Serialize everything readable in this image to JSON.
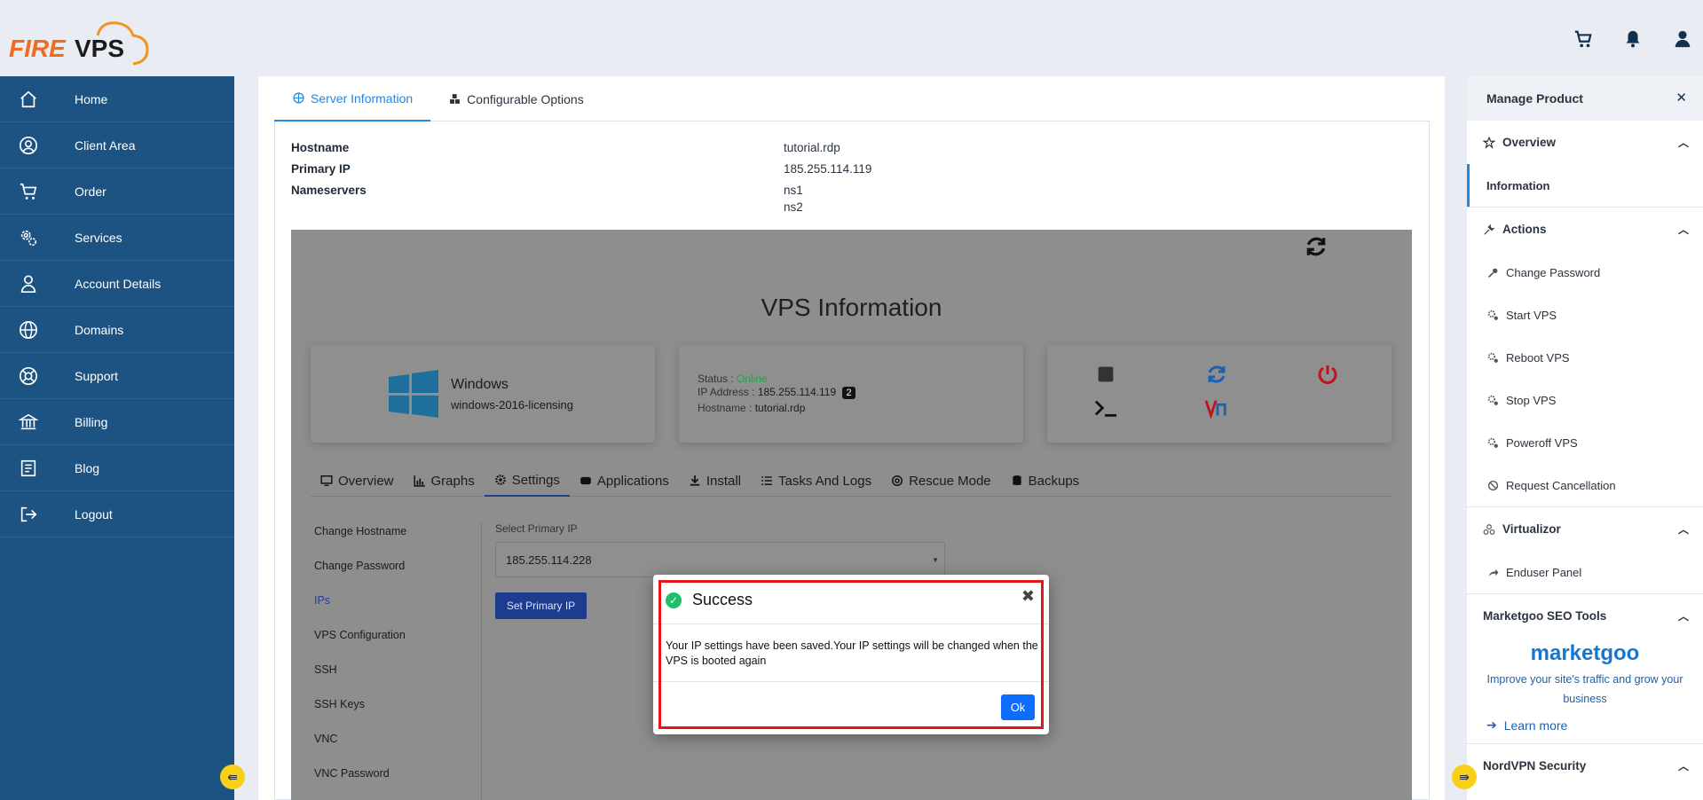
{
  "brand": {
    "logo_text_left": "FIRE",
    "logo_text_right": "VPS"
  },
  "header": {
    "icons": [
      "cart-icon",
      "bell-icon",
      "user-icon"
    ]
  },
  "sidebar": {
    "items": [
      {
        "label": "Home",
        "icon": "home-icon"
      },
      {
        "label": "Client Area",
        "icon": "user-circle-icon"
      },
      {
        "label": "Order",
        "icon": "cart-icon"
      },
      {
        "label": "Services",
        "icon": "gears-icon"
      },
      {
        "label": "Account Details",
        "icon": "user-icon"
      },
      {
        "label": "Domains",
        "icon": "globe-icon"
      },
      {
        "label": "Support",
        "icon": "lifering-icon"
      },
      {
        "label": "Billing",
        "icon": "bank-icon"
      },
      {
        "label": "Blog",
        "icon": "book-icon"
      },
      {
        "label": "Logout",
        "icon": "logout-icon"
      }
    ]
  },
  "main": {
    "tabs": [
      {
        "label": "Server Information",
        "icon": "globe-icon"
      },
      {
        "label": "Configurable Options",
        "icon": "cubes-icon"
      }
    ],
    "info": {
      "hostname_label": "Hostname",
      "hostname_value": "tutorial.rdp",
      "ip_label": "Primary IP",
      "ip_value": "185.255.114.119",
      "ns_label": "Nameservers",
      "ns1": "ns1",
      "ns2": "ns2"
    }
  },
  "vps": {
    "title": "VPS Information",
    "os_name": "Windows",
    "os_sub": "windows-2016-licensing",
    "status_label": "Status :",
    "status_value": "Online",
    "ip_label": "IP Address :",
    "ip_value": "185.255.114.119",
    "ip_count": "2",
    "host_label": "Hostname :",
    "host_value": "tutorial.rdp",
    "tabs": [
      {
        "label": "Overview",
        "icon": "monitor-icon"
      },
      {
        "label": "Graphs",
        "icon": "chart-icon"
      },
      {
        "label": "Settings",
        "icon": "gear-icon"
      },
      {
        "label": "Applications",
        "icon": "apps-icon"
      },
      {
        "label": "Install",
        "icon": "download-icon"
      },
      {
        "label": "Tasks And Logs",
        "icon": "list-icon"
      },
      {
        "label": "Rescue Mode",
        "icon": "lifering-icon"
      },
      {
        "label": "Backups",
        "icon": "database-icon"
      }
    ],
    "menu": [
      "Change Hostname",
      "Change Password",
      "IPs",
      "VPS Configuration",
      "SSH",
      "SSH Keys",
      "VNC",
      "VNC Password"
    ],
    "select_label": "Select Primary IP",
    "select_value": "185.255.114.228",
    "set_button": "Set Primary IP"
  },
  "modal": {
    "title": "Success",
    "message": "Your IP settings have been saved.Your IP settings will be changed when the VPS is booted again",
    "ok": "Ok"
  },
  "right_panel": {
    "title": "Manage Product",
    "overview": "Overview",
    "information": "Information",
    "actions": "Actions",
    "action_items": [
      "Change Password",
      "Start VPS",
      "Reboot VPS",
      "Stop VPS",
      "Poweroff VPS",
      "Request Cancellation"
    ],
    "virtualizor": "Virtualizor",
    "enduser": "Enduser Panel",
    "marketgoo_title": "Marketgoo SEO Tools",
    "marketgoo_logo": "marketgoo",
    "marketgoo_text": "Improve your site's traffic and grow your business",
    "learn_more": "Learn more",
    "nordvpn": "NordVPN Security"
  },
  "colors": {
    "sidebar": "#1d5382",
    "accent": "#1e88e5",
    "success": "#1fbf6b",
    "highlight": "#e4151b"
  }
}
